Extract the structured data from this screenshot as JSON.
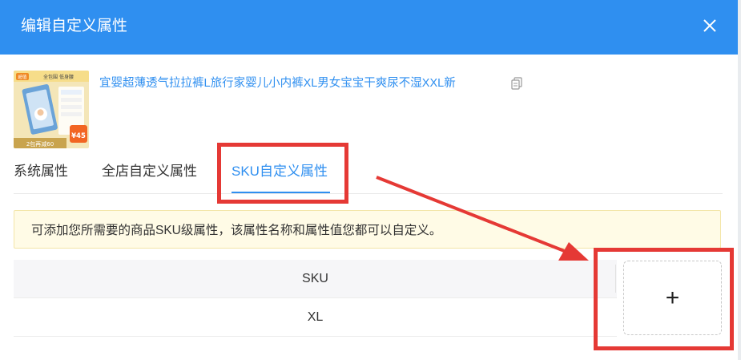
{
  "dialog": {
    "title": "编辑自定义属性",
    "close_icon": "close-icon"
  },
  "product": {
    "title": "宜婴超薄透气拉拉裤L旅行家婴儿小内裤XL男女宝宝干爽尿不湿XXL新",
    "thumbnail_text": {
      "tag": "超值",
      "badge": "全包围 低身腰",
      "promo": "2包再减60",
      "price": "¥45"
    },
    "copy_icon": "copy-icon"
  },
  "tabs": [
    {
      "label": "系统属性"
    },
    {
      "label": "全店自定义属性"
    },
    {
      "label": "SKU自定义属性",
      "active": true
    }
  ],
  "notice": "可添加您所需要的商品SKU级属性，该属性名称和属性值您都可以自定义。",
  "table": {
    "header": "SKU",
    "rows": [
      "XL"
    ]
  },
  "add_button": {
    "label": "+"
  },
  "colors": {
    "primary": "#2f8ff0",
    "highlight": "#e53935",
    "notice_bg": "#fffbe6"
  }
}
